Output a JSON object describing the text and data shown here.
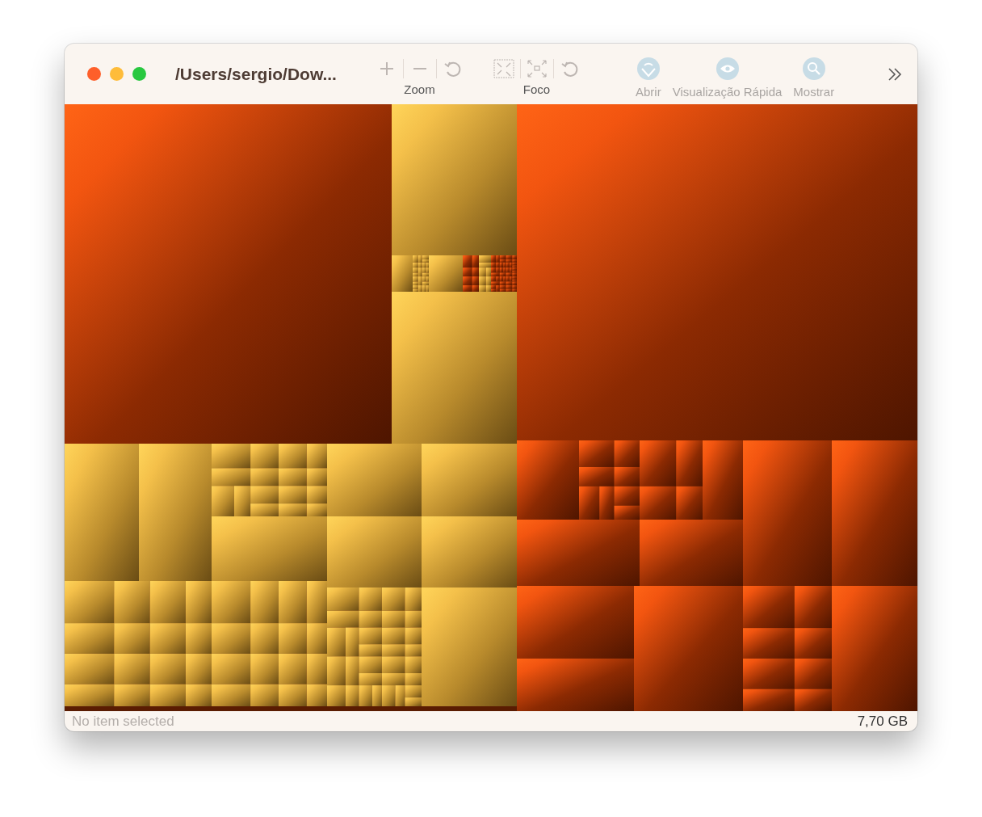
{
  "window": {
    "title": "/Users/sergio/Dow..."
  },
  "toolbar": {
    "groups": [
      {
        "label": "Zoom",
        "buttons": [
          {
            "kind": "plus",
            "disabled": true
          },
          {
            "kind": "minus",
            "disabled": true
          },
          {
            "kind": "reset",
            "disabled": true
          }
        ]
      },
      {
        "label": "Foco",
        "buttons": [
          {
            "kind": "shrink",
            "disabled": true
          },
          {
            "kind": "expand",
            "disabled": true
          },
          {
            "kind": "reset",
            "disabled": true
          }
        ]
      }
    ],
    "actions": [
      {
        "label": "Abrir",
        "kind": "open",
        "disabled": true
      },
      {
        "label": "Visualização Rápida",
        "kind": "eye",
        "disabled": true
      },
      {
        "label": "Mostrar",
        "kind": "search",
        "disabled": true
      }
    ]
  },
  "status_bar": {
    "selection": "No item selected",
    "total": "7,70 GB"
  }
}
